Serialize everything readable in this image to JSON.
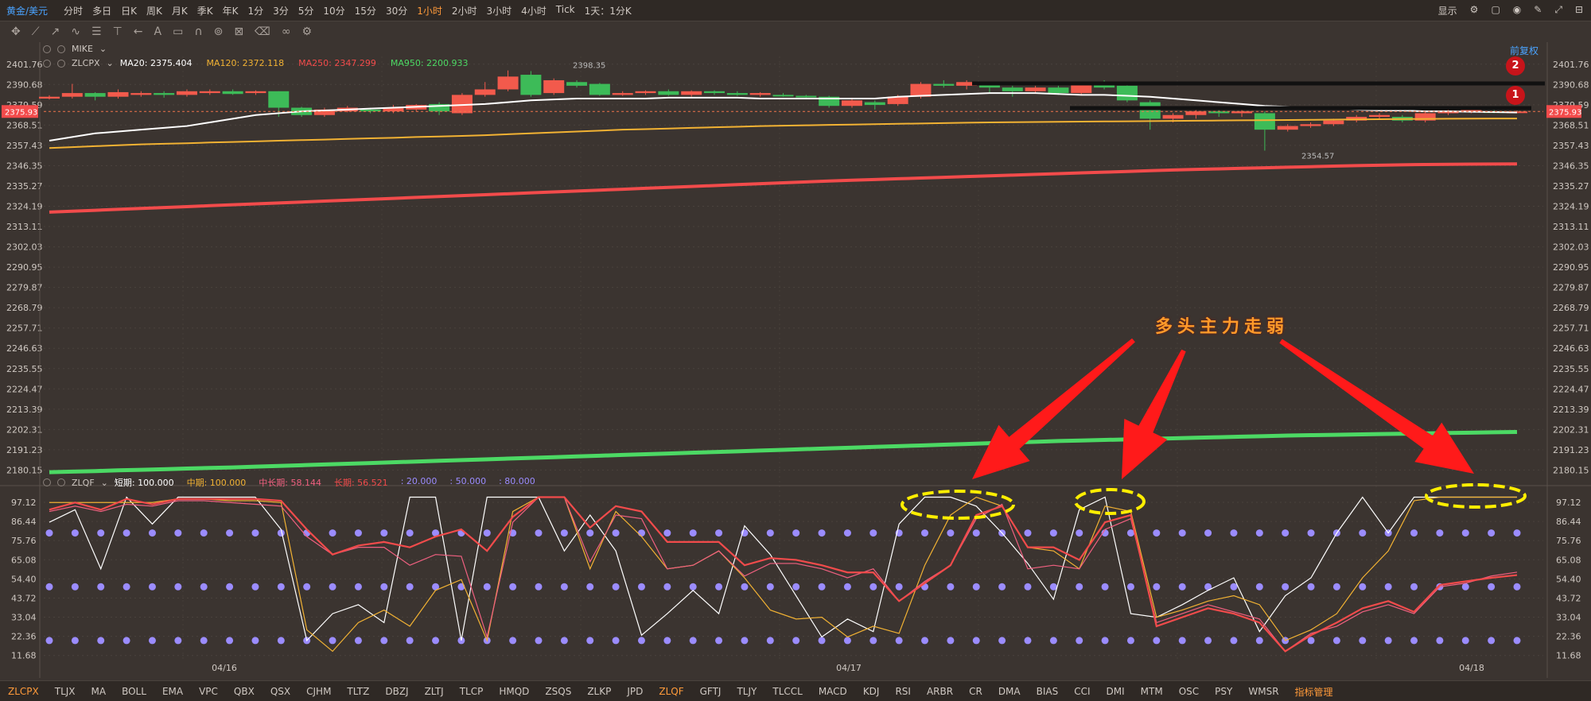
{
  "symbol": "黄金/美元",
  "periods": [
    "分时",
    "多日",
    "日K",
    "周K",
    "月K",
    "季K",
    "年K",
    "1分",
    "3分",
    "5分",
    "10分",
    "15分",
    "30分",
    "1小时",
    "2小时",
    "3小时",
    "4小时",
    "Tick",
    "1天：1分K"
  ],
  "active_period": "1小时",
  "top_right": {
    "display_label": "显示"
  },
  "fuquan_label": "前复权",
  "main_legend": {
    "mike": "MIKE",
    "indicator": "ZLCPX",
    "ma": [
      {
        "label": "MA20: 2375.404",
        "color": "#ffffff"
      },
      {
        "label": "MA120: 2372.118",
        "color": "#f2b233"
      },
      {
        "label": "MA250: 2347.299",
        "color": "#f24b4b"
      },
      {
        "label": "MA950: 2200.933",
        "color": "#4cd964"
      }
    ]
  },
  "sub_legend": {
    "indicator": "ZLQF",
    "items": [
      {
        "label": "短期: 100.000",
        "color": "#ffffff"
      },
      {
        "label": "中期: 100.000",
        "color": "#f2b233"
      },
      {
        "label": "中长期: 58.144",
        "color": "#f06080"
      },
      {
        "label": "长期: 56.521",
        "color": "#f24b4b"
      },
      {
        "label": ": 20.000",
        "color": "#9b8cff"
      },
      {
        "label": ": 50.000",
        "color": "#9b8cff"
      },
      {
        "label": ": 80.000",
        "color": "#9b8cff"
      }
    ]
  },
  "annotation_text": "多头主力走弱",
  "markers": [
    "1",
    "2"
  ],
  "price_tags": {
    "current": "2375.93",
    "high": "2398.35",
    "low": "2354.57"
  },
  "indicators": [
    "ZLCPX",
    "TLJX",
    "MA",
    "BOLL",
    "EMA",
    "VPC",
    "QBX",
    "QSX",
    "CJHM",
    "TLTZ",
    "DBZJ",
    "ZLTJ",
    "TLCP",
    "HMQD",
    "ZSQS",
    "ZLKP",
    "JPD",
    "ZLQF",
    "GFTJ",
    "TLJY",
    "TLCCL",
    "MACD",
    "KDJ",
    "RSI",
    "ARBR",
    "CR",
    "DMA",
    "BIAS",
    "CCI",
    "DMI",
    "MTM",
    "OSC",
    "PSY",
    "WMSR",
    "指标管理"
  ],
  "active_indicators": [
    "ZLCPX",
    "ZLQF"
  ],
  "colors": {
    "bg": "#3b3430",
    "up": "#f25a4c",
    "down": "#3dbb58",
    "ma20": "#ffffff",
    "ma120": "#f2b233",
    "ma250": "#f24b4b",
    "ma950": "#4cd964",
    "dots": "#9b8cff",
    "annotation": "#ff1a1a",
    "ellipse": "#ffee00"
  },
  "chart_data": [
    {
      "type": "candlestick",
      "title": "ZLCPX",
      "y_ticks": [
        "2401.76",
        "2390.68",
        "2379.59",
        "2368.51",
        "2357.43",
        "2346.35",
        "2335.27",
        "2324.19",
        "2313.11",
        "2302.03",
        "2290.95",
        "2279.87",
        "2268.79",
        "2257.71",
        "2246.63",
        "2235.55",
        "2224.47",
        "2213.39",
        "2202.31",
        "2191.23",
        "2180.15"
      ],
      "ylim": [
        2176,
        2406
      ],
      "x_ticks": [
        "04/16",
        "04/17",
        "04/18"
      ],
      "candles": [
        [
          2383,
          2384,
          2384.8,
          2382.5
        ],
        [
          2384,
          2386,
          2391,
          2383
        ],
        [
          2386,
          2384,
          2386.5,
          2382
        ],
        [
          2384,
          2386.5,
          2388,
          2383
        ],
        [
          2385,
          2386,
          2387,
          2384
        ],
        [
          2386,
          2385,
          2387,
          2383.5
        ],
        [
          2385,
          2387,
          2388,
          2384
        ],
        [
          2386,
          2387,
          2388,
          2385
        ],
        [
          2387,
          2385.5,
          2388,
          2385
        ],
        [
          2386,
          2387,
          2387.5,
          2385
        ],
        [
          2387,
          2378,
          2387,
          2373
        ],
        [
          2378,
          2374,
          2378.5,
          2373
        ],
        [
          2374,
          2377,
          2378,
          2373
        ],
        [
          2376,
          2378,
          2379,
          2375.5
        ],
        [
          2377,
          2376,
          2378,
          2375
        ],
        [
          2376,
          2378,
          2379.5,
          2375
        ],
        [
          2377,
          2379.5,
          2380,
          2376
        ],
        [
          2380,
          2376,
          2381,
          2374
        ],
        [
          2375,
          2385,
          2386,
          2374
        ],
        [
          2385,
          2388,
          2392,
          2384
        ],
        [
          2388,
          2395,
          2398.35,
          2387
        ],
        [
          2396,
          2385,
          2398,
          2384
        ],
        [
          2386,
          2393,
          2394,
          2385
        ],
        [
          2392,
          2390,
          2393,
          2389
        ],
        [
          2391,
          2385,
          2391.5,
          2384.5
        ],
        [
          2385,
          2386,
          2387,
          2384.5
        ],
        [
          2386,
          2387,
          2387.5,
          2385
        ],
        [
          2387,
          2385,
          2388,
          2384.5
        ],
        [
          2385,
          2387,
          2387.5,
          2384
        ],
        [
          2387,
          2386,
          2387.5,
          2385
        ],
        [
          2386,
          2385,
          2387,
          2384.5
        ],
        [
          2385,
          2386,
          2386.5,
          2384
        ],
        [
          2385,
          2384.5,
          2386,
          2384
        ],
        [
          2384.5,
          2384,
          2385,
          2383.5
        ],
        [
          2384,
          2379,
          2384.5,
          2378
        ],
        [
          2379,
          2382,
          2383,
          2378
        ],
        [
          2381,
          2379.5,
          2382,
          2377
        ],
        [
          2380,
          2384,
          2385,
          2379
        ],
        [
          2384,
          2391,
          2392,
          2383
        ],
        [
          2391,
          2390,
          2393,
          2389
        ],
        [
          2390,
          2392,
          2393,
          2388
        ],
        [
          2391,
          2389,
          2392,
          2386
        ],
        [
          2389,
          2387,
          2390,
          2384
        ],
        [
          2387,
          2389,
          2390,
          2386
        ],
        [
          2389,
          2386,
          2390,
          2385
        ],
        [
          2386,
          2391,
          2392,
          2385
        ],
        [
          2391,
          2389,
          2393,
          2388
        ],
        [
          2390,
          2382,
          2390.5,
          2381
        ],
        [
          2381,
          2372,
          2382,
          2366
        ],
        [
          2372,
          2374,
          2375,
          2370
        ],
        [
          2374,
          2376,
          2377,
          2372
        ],
        [
          2376,
          2375,
          2377,
          2373
        ],
        [
          2375,
          2376,
          2377,
          2373
        ],
        [
          2375,
          2366,
          2376,
          2354.57
        ],
        [
          2366,
          2368,
          2369,
          2365
        ],
        [
          2368,
          2369,
          2370,
          2367
        ],
        [
          2369,
          2371,
          2372,
          2368
        ],
        [
          2371,
          2373,
          2374,
          2370
        ],
        [
          2373,
          2374,
          2375,
          2372
        ],
        [
          2373,
          2371,
          2374,
          2370
        ],
        [
          2371,
          2375,
          2376,
          2370
        ],
        [
          2375,
          2376,
          2377,
          2374
        ],
        [
          2376,
          2377,
          2378,
          2375
        ],
        [
          2376,
          2375.5,
          2377,
          2375
        ],
        [
          2375.5,
          2375.93,
          2376.5,
          2375
        ]
      ],
      "series": [
        {
          "name": "MA20",
          "values": [
            2360,
            2362,
            2364,
            2365,
            2366,
            2367,
            2368,
            2370,
            2372,
            2374,
            2375,
            2376,
            2376.5,
            2377,
            2377.5,
            2378,
            2378.5,
            2379,
            2379.5,
            2380,
            2381,
            2382,
            2382.5,
            2383,
            2383,
            2383,
            2383,
            2383.5,
            2383.5,
            2383.5,
            2383.5,
            2383,
            2383,
            2383,
            2383,
            2383,
            2383,
            2384,
            2384.5,
            2385,
            2385.5,
            2386,
            2386,
            2386,
            2385.5,
            2385,
            2385,
            2384.5,
            2384,
            2383,
            2382,
            2381,
            2380,
            2379,
            2378.5,
            2378,
            2377.5,
            2377,
            2376.5,
            2376.5,
            2376,
            2376,
            2375.8,
            2375.6,
            2375.4
          ]
        },
        {
          "name": "MA120",
          "values": [
            2356,
            2356.5,
            2357,
            2357.5,
            2358,
            2358.3,
            2358.6,
            2359,
            2359.3,
            2359.6,
            2360,
            2360.3,
            2360.6,
            2361,
            2361.3,
            2361.6,
            2362,
            2362.3,
            2362.6,
            2363,
            2363.5,
            2364,
            2364.5,
            2365,
            2365.5,
            2366,
            2366.3,
            2366.6,
            2367,
            2367.3,
            2367.6,
            2368,
            2368.2,
            2368.4,
            2368.6,
            2368.8,
            2369,
            2369.2,
            2369.4,
            2369.6,
            2369.8,
            2370,
            2370.1,
            2370.2,
            2370.3,
            2370.4,
            2370.5,
            2370.6,
            2370.7,
            2370.8,
            2370.9,
            2371,
            2371.1,
            2371.2,
            2371.3,
            2371.4,
            2371.5,
            2371.6,
            2371.7,
            2371.8,
            2371.9,
            2372,
            2372.05,
            2372.1,
            2372.118
          ]
        },
        {
          "name": "MA250",
          "values": [
            2321,
            2321.5,
            2322,
            2322.5,
            2323,
            2323.5,
            2324,
            2324.5,
            2325,
            2325.5,
            2326,
            2326.5,
            2327,
            2327.5,
            2328,
            2328.5,
            2329,
            2329.5,
            2330,
            2330.5,
            2331,
            2331.5,
            2332,
            2332.5,
            2333,
            2333.5,
            2334,
            2334.5,
            2335,
            2335.5,
            2336,
            2336.5,
            2337,
            2337.5,
            2338,
            2338.4,
            2338.8,
            2339.2,
            2339.6,
            2340,
            2340.4,
            2340.8,
            2341.2,
            2341.6,
            2342,
            2342.4,
            2342.8,
            2343.2,
            2343.6,
            2344,
            2344.3,
            2344.6,
            2344.9,
            2345.2,
            2345.5,
            2345.8,
            2346.1,
            2346.4,
            2346.6,
            2346.8,
            2347,
            2347.1,
            2347.2,
            2347.25,
            2347.299
          ]
        },
        {
          "name": "MA950",
          "values": [
            2179,
            2179.3,
            2179.6,
            2180,
            2180.3,
            2180.6,
            2181,
            2181.3,
            2181.6,
            2182,
            2182.4,
            2182.8,
            2183.2,
            2183.6,
            2184,
            2184.4,
            2184.8,
            2185.2,
            2185.6,
            2186,
            2186.4,
            2186.8,
            2187.2,
            2187.6,
            2188,
            2188.4,
            2188.8,
            2189.2,
            2189.6,
            2190,
            2190.4,
            2190.8,
            2191.2,
            2191.6,
            2192,
            2192.4,
            2192.8,
            2193.2,
            2193.6,
            2194,
            2194.4,
            2194.8,
            2195.2,
            2195.6,
            2196,
            2196.3,
            2196.6,
            2196.9,
            2197.2,
            2197.5,
            2197.8,
            2198.1,
            2198.4,
            2198.7,
            2199,
            2199.2,
            2199.4,
            2199.6,
            2199.8,
            2200,
            2200.2,
            2200.4,
            2200.6,
            2200.8,
            2200.933
          ]
        }
      ]
    },
    {
      "type": "line",
      "title": "ZLQF",
      "y_ticks": [
        "97.12",
        "86.44",
        "75.76",
        "65.08",
        "54.40",
        "43.72",
        "33.04",
        "22.36",
        "11.68"
      ],
      "ylim": [
        8,
        102
      ],
      "series": [
        {
          "name": "短期",
          "values": [
            86,
            93,
            60,
            100,
            85,
            100,
            100,
            100,
            100,
            82,
            20,
            35,
            40,
            30,
            100,
            100,
            20,
            100,
            100,
            100,
            70,
            90,
            70,
            23,
            35,
            48,
            35,
            84,
            68,
            45,
            22,
            32,
            25,
            85,
            100,
            100,
            95,
            80,
            63,
            43,
            93,
            100,
            35,
            33,
            40,
            48,
            55,
            25,
            45,
            55,
            80,
            100,
            80,
            100,
            100,
            100,
            100,
            100
          ]
        },
        {
          "name": "中期",
          "values": [
            97,
            97,
            97,
            97,
            97,
            99,
            99,
            98,
            98,
            97,
            26,
            14,
            30,
            37,
            28,
            48,
            54,
            20,
            92,
            100,
            100,
            60,
            92,
            78,
            60,
            62,
            70,
            55,
            37,
            32,
            33,
            22,
            28,
            24,
            62,
            90,
            100,
            95,
            72,
            70,
            60,
            95,
            92,
            33,
            37,
            42,
            45,
            40,
            20,
            26,
            35,
            55,
            70,
            98,
            100,
            100,
            100,
            100
          ]
        },
        {
          "name": "中长期",
          "values": [
            92,
            95,
            92,
            96,
            95,
            98,
            98,
            97,
            96,
            95,
            78,
            68,
            72,
            72,
            62,
            68,
            67,
            22,
            86,
            100,
            100,
            64,
            90,
            88,
            60,
            62,
            70,
            56,
            63,
            63,
            60,
            55,
            60,
            42,
            53,
            62,
            88,
            96,
            60,
            62,
            60,
            82,
            88,
            30,
            35,
            40,
            36,
            32,
            14,
            24,
            28,
            36,
            40,
            35,
            50,
            52,
            56,
            58.144
          ]
        },
        {
          "name": "长期",
          "values": [
            93,
            97,
            93,
            99,
            96,
            99,
            99,
            99,
            99,
            98,
            82,
            68,
            73,
            75,
            72,
            78,
            82,
            70,
            89,
            100,
            100,
            83,
            95,
            92,
            75,
            75,
            75,
            62,
            66,
            65,
            62,
            58,
            58,
            42,
            52,
            62,
            90,
            95,
            72,
            72,
            65,
            86,
            90,
            28,
            33,
            38,
            35,
            30,
            14,
            23,
            30,
            38,
            42,
            36,
            51,
            53,
            55,
            56.521
          ]
        }
      ],
      "ref_levels": [
        20,
        50,
        80
      ]
    }
  ]
}
